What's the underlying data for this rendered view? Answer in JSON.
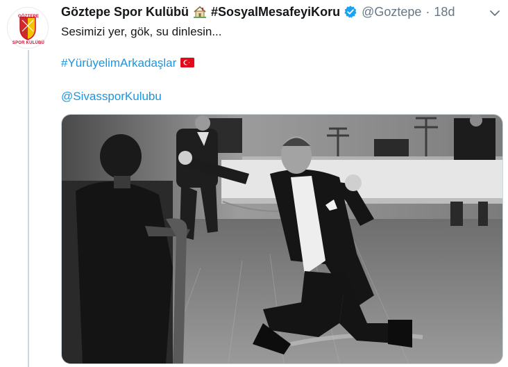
{
  "tweet": {
    "author": {
      "name": "Göztepe Spor Kulübü",
      "hashtag_name": "#SosyalMesafeyiKoru",
      "handle": "@Goztepe",
      "separator": "·",
      "time": "18d",
      "avatar_crest_top": "GÖZTEPE",
      "avatar_crest_bottom": "SPOR KULÜBÜ",
      "house_icon": "house-emoji-icon",
      "verified_icon": "verified-badge-icon"
    },
    "text_line": "Sesimizi yer, gök, su dinlesin...",
    "hashtag": "#YürüyelimArkadaşlar",
    "flag_icon": "turkey-flag-icon",
    "mention": "@SivassporKulubu",
    "menu_icon": "chevron-down-icon"
  },
  "colors": {
    "link": "#1b95e0",
    "verified": "#1da1f2",
    "crest_red": "#c8102e",
    "crest_yellow": "#f5c400",
    "secondary_text": "#657786"
  }
}
